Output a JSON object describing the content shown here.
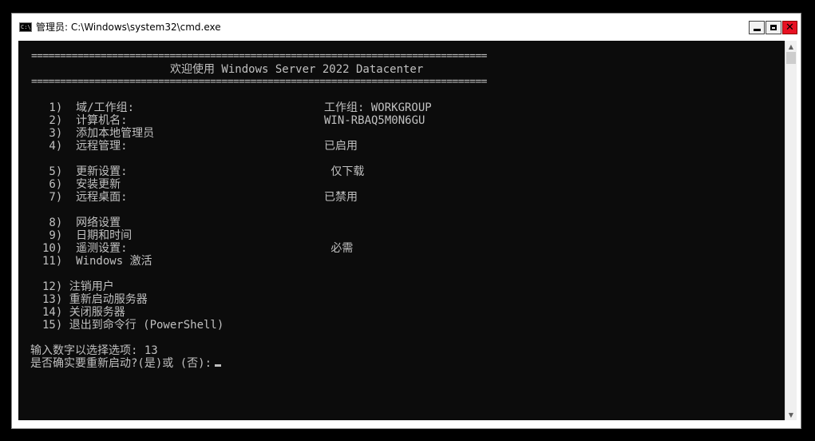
{
  "window": {
    "title": "管理员: C:\\Windows\\system32\\cmd.exe",
    "icon": "cmd-icon",
    "icon_text": "C:\\",
    "controls": {
      "minimize": "minimize-icon",
      "maximize": "maximize-icon",
      "close": "✕"
    }
  },
  "console": {
    "rule": "===============================================================================",
    "heading": "欢迎使用 Windows Server 2022 Datacenter",
    "menu": [
      {
        "num": " 1)",
        "label": "域/工作组:",
        "value": "工作组: WORKGROUP"
      },
      {
        "num": " 2)",
        "label": "计算机名:",
        "value": "WIN-RBAQ5M0N6GU"
      },
      {
        "num": " 3)",
        "label": "添加本地管理员",
        "value": ""
      },
      {
        "num": " 4)",
        "label": "远程管理:",
        "value": "已启用"
      },
      {
        "num": " 5)",
        "label": "更新设置:",
        "value": " 仅下载"
      },
      {
        "num": " 6)",
        "label": "安装更新",
        "value": ""
      },
      {
        "num": " 7)",
        "label": "远程桌面:",
        "value": "已禁用"
      },
      {
        "num": " 8)",
        "label": "网络设置",
        "value": ""
      },
      {
        "num": " 9)",
        "label": "日期和时间",
        "value": ""
      },
      {
        "num": "10)",
        "label": "遥测设置:",
        "value": " 必需"
      },
      {
        "num": "11)",
        "label": "Windows 激活",
        "value": ""
      },
      {
        "num": "12)",
        "label": "注销用户",
        "value": ""
      },
      {
        "num": "13)",
        "label": "重新启动服务器",
        "value": ""
      },
      {
        "num": "14)",
        "label": "关闭服务器",
        "value": ""
      },
      {
        "num": "15)",
        "label": "退出到命令行 (PowerShell)",
        "value": ""
      }
    ],
    "prompt_select": "输入数字以选择选项: 13",
    "prompt_confirm": "是否确实要重新启动?(是)或 (否):"
  },
  "scrollbar": {
    "up": "▲",
    "down": "▼"
  }
}
